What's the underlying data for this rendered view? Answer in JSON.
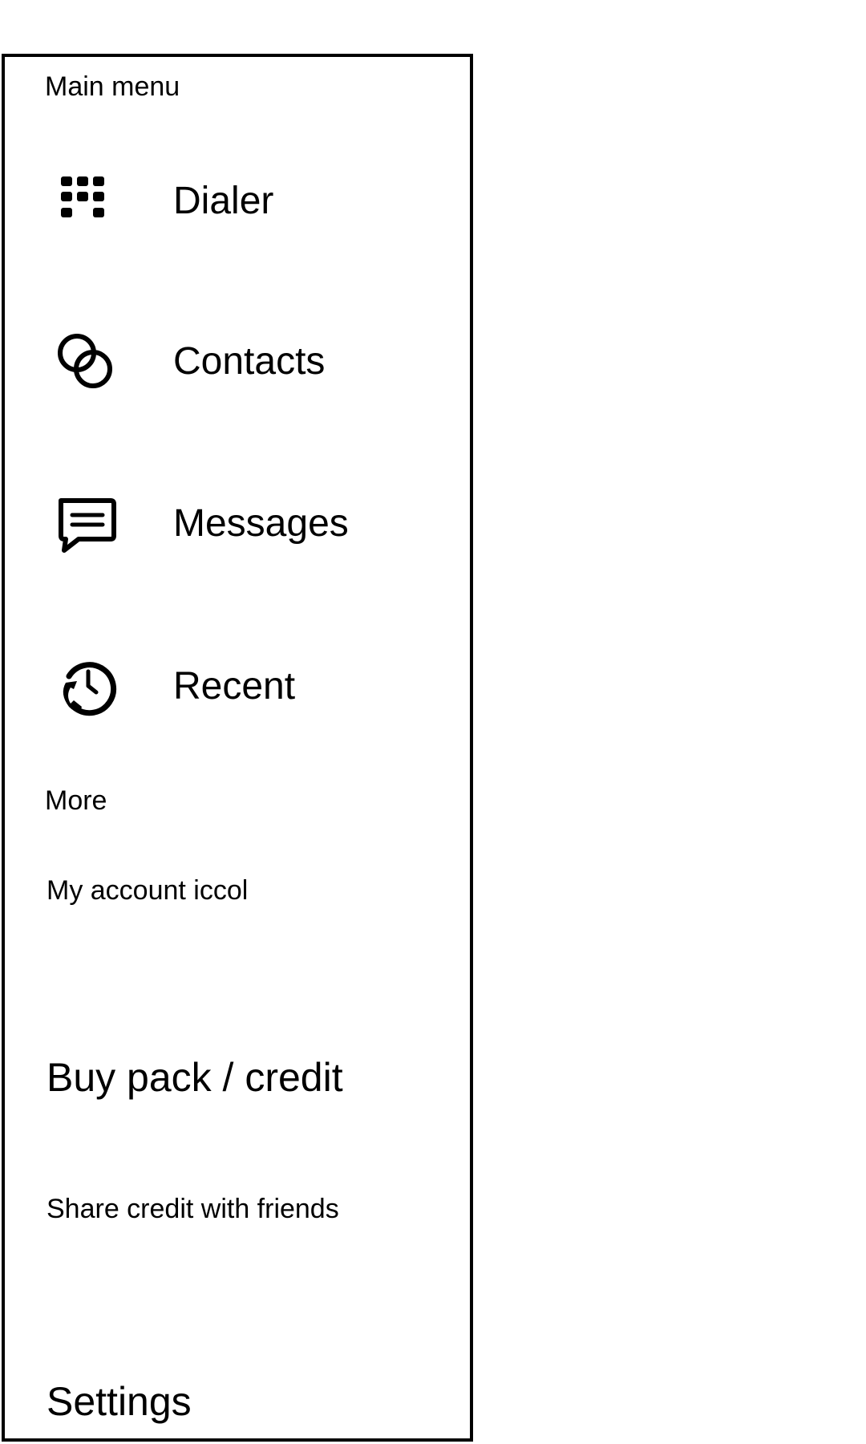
{
  "drawer": {
    "main_menu_title": "Main menu",
    "nav_items": [
      {
        "label": "Dialer",
        "icon": "dialpad-icon"
      },
      {
        "label": "Contacts",
        "icon": "contacts-rings-icon"
      },
      {
        "label": "Messages",
        "icon": "message-bubble-icon"
      },
      {
        "label": "Recent",
        "icon": "recent-calls-icon"
      }
    ],
    "more_title": "More",
    "more_items": [
      {
        "label": "My account iccol"
      },
      {
        "label": "Buy pack / credit"
      },
      {
        "label": "Share credit with friends"
      },
      {
        "label": "Settings"
      }
    ]
  },
  "colors": {
    "background": "#ffffff",
    "foreground": "#000000"
  }
}
